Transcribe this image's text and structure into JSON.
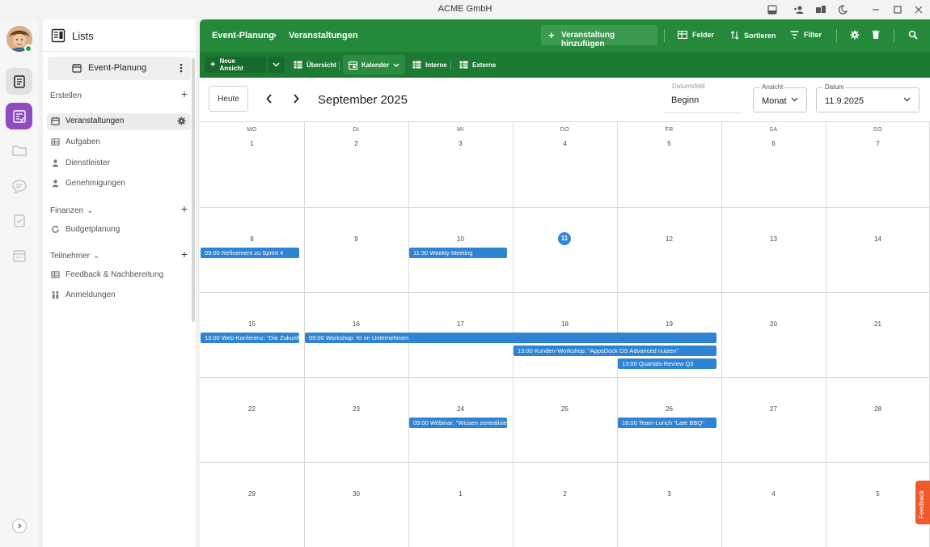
{
  "window": {
    "title": "ACME GmbH"
  },
  "panel": {
    "title": "Lists",
    "workspace": "Event-Planung",
    "create_label": "Erstellen",
    "groups": [
      {
        "label": "Finanzen"
      },
      {
        "label": "Teilnehmer"
      }
    ],
    "items": [
      {
        "label": "Veranstaltungen"
      },
      {
        "label": "Aufgaben"
      },
      {
        "label": "Dienstleister"
      },
      {
        "label": "Genehmigungen"
      },
      {
        "label": "Budgetplanung"
      },
      {
        "label": "Feedback & Nachbereitung"
      },
      {
        "label": "Anmeldungen"
      }
    ]
  },
  "topbar": {
    "breadcrumb": [
      "Event-Planung",
      "Veranstaltungen"
    ],
    "add_label": "Veranstaltung hinzufügen",
    "felder": "Felder",
    "sortieren": "Sortieren",
    "filter": "Filter"
  },
  "views": {
    "new_view": "Neue Ansicht",
    "overview": "Übersicht",
    "calendar": "Kalender",
    "internal": "Interne",
    "external": "Externe"
  },
  "calendar": {
    "today_label": "Heute",
    "month_label": "September 2025",
    "date_field_label": "Datumsfeld",
    "date_field_value": "Beginn",
    "view_label": "Ansicht",
    "view_value": "Monat",
    "date_label": "Datum",
    "date_value": "11.9.2025",
    "weekdays": [
      "MO",
      "DI",
      "MI",
      "DO",
      "FR",
      "SA",
      "SO"
    ],
    "weeks": [
      [
        "1",
        "2",
        "3",
        "4",
        "5",
        "6",
        "7"
      ],
      [
        "8",
        "9",
        "10",
        "11",
        "12",
        "13",
        "14"
      ],
      [
        "15",
        "16",
        "17",
        "18",
        "19",
        "20",
        "21"
      ],
      [
        "22",
        "23",
        "24",
        "25",
        "26",
        "27",
        "28"
      ],
      [
        "29",
        "30",
        "1",
        "2",
        "3",
        "4",
        "5"
      ]
    ],
    "today": "11",
    "events": [
      {
        "text": "09:00 Refinement zu Sprint 4"
      },
      {
        "text": "11:30 Weekly Meeting"
      },
      {
        "text": "13:00 Web-Konferenz: \"Die Zukunft"
      },
      {
        "text": "09:00 Workshop: KI im Unternehmen"
      },
      {
        "text": "13:00 Kunden-Workshop: \"AppsDock OS Advanced nutzen\""
      },
      {
        "text": "13:00 Quartals-Review Q3"
      },
      {
        "text": "09:00 Webinar: \"Wissen zentralisieren"
      },
      {
        "text": "18:00 Team-Lunch \"Late BBQ\""
      }
    ]
  },
  "feedback_label": "Feedback"
}
